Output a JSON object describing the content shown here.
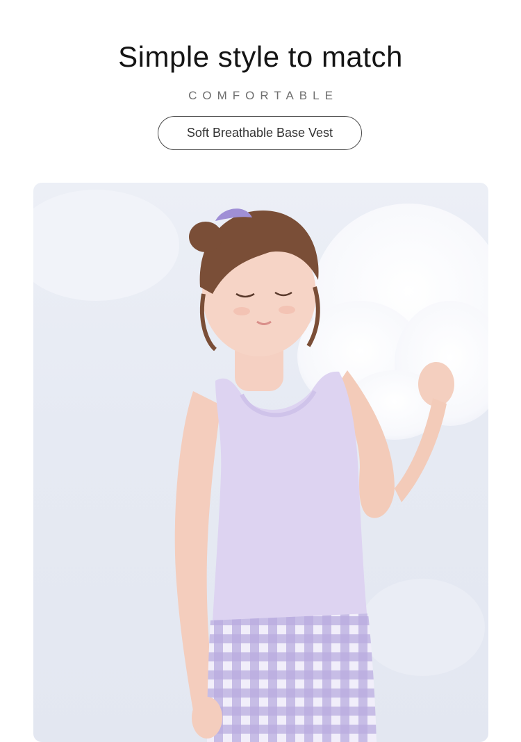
{
  "header": {
    "title": "Simple style to match",
    "subtitle": "COMFORTABLE",
    "tag": "Soft Breathable Base Vest"
  },
  "photo": {
    "subject": "girl-in-lavender-tank-top",
    "colors": {
      "background": "#e6eaf3",
      "vest": "#ddd3f1",
      "plaid": "#a89ad8",
      "hair": "#7a4e37",
      "skin": "#f6d4c6",
      "cloud": "#ffffff"
    }
  }
}
